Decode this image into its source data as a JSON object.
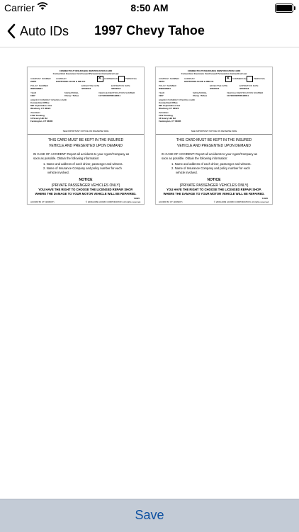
{
  "status_bar": {
    "carrier": "Carrier",
    "time": "8:50 AM"
  },
  "nav": {
    "back_label": "Auto IDs",
    "title": "1997 Chevy Tahoe"
  },
  "card": {
    "heading1": "CONNECTICUT INSURANCE IDENTIFICATION CARD",
    "heading2": "Connecticut Insurance Card Issued Pursuant to Connecticut Law",
    "company_number_label": "COMPANY NUMBER",
    "company_number": "22357",
    "company_label": "COMPANY",
    "company": "HARTFORD ACCID & IND CO",
    "commercial": "COMMERCIAL",
    "personal": "PERSONAL",
    "policy_number_label": "POLICY NUMBER",
    "policy_number": "WB0HHM04",
    "effective_date_label": "EFFECTIVE DATE",
    "effective_date": "3/20/2015",
    "expiration_date_label": "EXPIRATION DATE",
    "expiration_date": "3/20/2016",
    "year_label": "YEAR",
    "year": "1997",
    "make_label": "MAKE/MODEL",
    "make": "Chevy / Tahoe",
    "vin_label": "VEHICLE IDENTIFICATION NUMBER",
    "vin": "1GYEK63N76R193811",
    "agency_label": "AGENCY/COMPANY ISSUING CARD",
    "agency_lines": [
      "Connecticut Office",
      "690 Asylumnless Ave",
      "Westbury, CT 06023"
    ],
    "insured_label": "INSURED",
    "insured_lines": [
      "FTW Trucking",
      "16 Scarry Hill Rd",
      "Farmington, CT 06085"
    ],
    "reverse_note": "SEE IMPORTANT NOTICE ON REVERSE SIDE",
    "keep_1": "THIS CARD MUST BE KEPT IN THE INSURED",
    "keep_2": "VEHICLE AND PRESENTED UPON DEMAND",
    "accident_1": "IN CASE OF ACCIDENT:  Report all accidents to your Agent/Company as",
    "accident_2": "soon as possible.  Obtain the following information:",
    "item_1": "1. Name and address of each driver, passenger and witness.",
    "item_2a": "2. Name of Insurance Company and policy number for each",
    "item_2b": "vehicle involved.",
    "notice": "NOTICE",
    "private": "(PRIVATE PASSENGER VEHICLES ONLY)",
    "right_1": "YOU HAVE THE RIGHT TO CHOOSE THE LICENSED REPAIR SHOP.",
    "right_2": "WHERE THE DAMAGE TO YOUR MOTOR VEHICLE WILL BE REPAIRED.",
    "form_code": "74025",
    "footer_left": "ACORD 50 CT (2009/07)",
    "footer_right": "© 2009-2009 ACORD CORPORATION. All rights reserved."
  },
  "footer": {
    "save_label": "Save"
  },
  "colors": {
    "accent": "#0b4fa0",
    "toolbar": "#c3cbd6"
  }
}
